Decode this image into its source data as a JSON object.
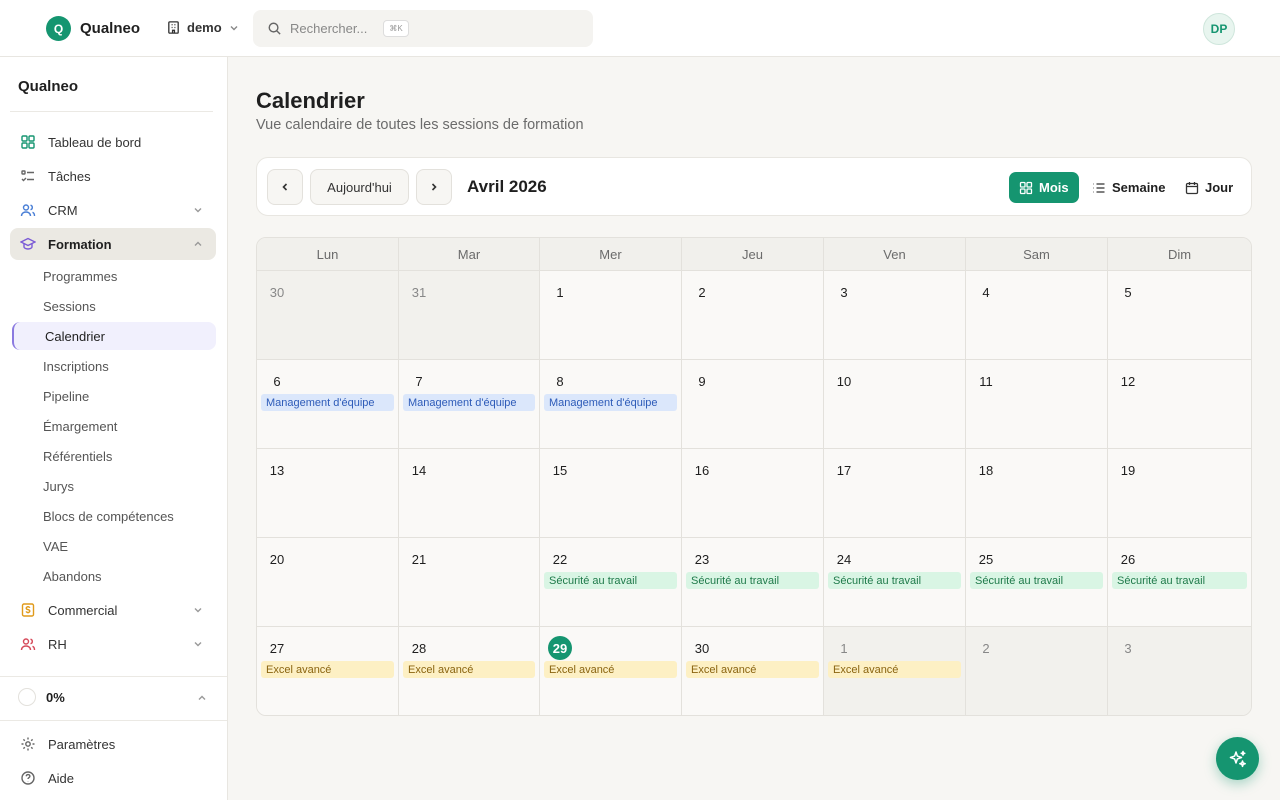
{
  "app": {
    "logo_letter": "Q",
    "name": "Qualneo"
  },
  "workspace": {
    "label": "demo"
  },
  "search": {
    "placeholder": "Rechercher...",
    "shortcut": "⌘K"
  },
  "user": {
    "initials": "DP"
  },
  "sidebar": {
    "brand": "Qualneo",
    "nav": [
      {
        "label": "Tableau de bord",
        "icon": "dashboard-icon"
      },
      {
        "label": "Tâches",
        "icon": "tasks-icon"
      },
      {
        "label": "CRM",
        "icon": "users-icon"
      },
      {
        "label": "Formation",
        "icon": "graduation-cap-icon"
      }
    ],
    "formation_sub": [
      "Programmes",
      "Sessions",
      "Calendrier",
      "Inscriptions",
      "Pipeline",
      "Émargement",
      "Référentiels",
      "Jurys",
      "Blocs de compétences",
      "VAE",
      "Abandons"
    ],
    "nav_after": [
      {
        "label": "Commercial",
        "icon": "dollar-icon"
      },
      {
        "label": "RH",
        "icon": "people-icon"
      }
    ],
    "progress": "0%",
    "bottom": [
      {
        "label": "Paramètres",
        "icon": "gear-icon"
      },
      {
        "label": "Aide",
        "icon": "help-icon"
      }
    ]
  },
  "page": {
    "title": "Calendrier",
    "subtitle": "Vue calendaire de toutes les sessions de formation"
  },
  "toolbar": {
    "today": "Aujourd'hui",
    "month": "Avril 2026",
    "views": {
      "month": "Mois",
      "week": "Semaine",
      "day": "Jour"
    }
  },
  "calendar": {
    "days_of_week": [
      "Lun",
      "Mar",
      "Mer",
      "Jeu",
      "Ven",
      "Sam",
      "Dim"
    ],
    "weeks": [
      [
        {
          "d": "30",
          "m": true
        },
        {
          "d": "31",
          "m": true
        },
        {
          "d": "1"
        },
        {
          "d": "2"
        },
        {
          "d": "3"
        },
        {
          "d": "4"
        },
        {
          "d": "5"
        }
      ],
      [
        {
          "d": "6",
          "e": "Management d'équipe",
          "c": "blue"
        },
        {
          "d": "7",
          "e": "Management d'équipe",
          "c": "blue"
        },
        {
          "d": "8",
          "e": "Management d'équipe",
          "c": "blue"
        },
        {
          "d": "9"
        },
        {
          "d": "10"
        },
        {
          "d": "11"
        },
        {
          "d": "12"
        }
      ],
      [
        {
          "d": "13"
        },
        {
          "d": "14"
        },
        {
          "d": "15"
        },
        {
          "d": "16"
        },
        {
          "d": "17"
        },
        {
          "d": "18"
        },
        {
          "d": "19"
        }
      ],
      [
        {
          "d": "20"
        },
        {
          "d": "21"
        },
        {
          "d": "22",
          "e": "Sécurité au travail",
          "c": "green"
        },
        {
          "d": "23",
          "e": "Sécurité au travail",
          "c": "green"
        },
        {
          "d": "24",
          "e": "Sécurité au travail",
          "c": "green"
        },
        {
          "d": "25",
          "e": "Sécurité au travail",
          "c": "green"
        },
        {
          "d": "26",
          "e": "Sécurité au travail",
          "c": "green"
        }
      ],
      [
        {
          "d": "27",
          "e": "Excel avancé",
          "c": "yellow"
        },
        {
          "d": "28",
          "e": "Excel avancé",
          "c": "yellow"
        },
        {
          "d": "29",
          "e": "Excel avancé",
          "c": "yellow",
          "today": true
        },
        {
          "d": "30",
          "e": "Excel avancé",
          "c": "yellow"
        },
        {
          "d": "1",
          "m": true,
          "e": "Excel avancé",
          "c": "yellow"
        },
        {
          "d": "2",
          "m": true
        },
        {
          "d": "3",
          "m": true
        }
      ]
    ],
    "event_colors": {
      "blue": {
        "bg": "#dbe7fb",
        "fg": "#2d5bb8"
      },
      "green": {
        "bg": "#d9f5e4",
        "fg": "#1f7a4a"
      },
      "yellow": {
        "bg": "#fdf0c4",
        "fg": "#8a6410"
      }
    }
  },
  "colors": {
    "accent": "#159570"
  }
}
